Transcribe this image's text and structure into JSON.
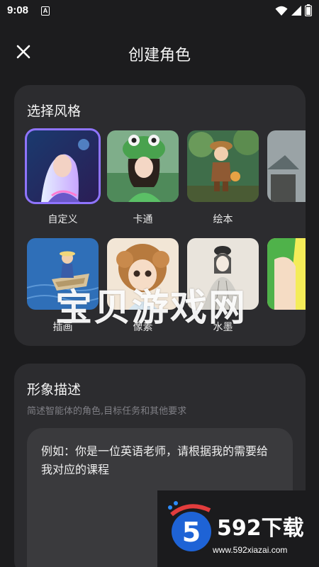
{
  "status_bar": {
    "time": "9:08",
    "notification_badge": "A",
    "icons": [
      "wifi-icon",
      "signal-icon",
      "battery-icon"
    ]
  },
  "header": {
    "title": "创建角色",
    "close_icon": "close-icon"
  },
  "style_section": {
    "heading": "选择风格",
    "items": [
      {
        "label": "自定义",
        "selected": true
      },
      {
        "label": "卡通",
        "selected": false
      },
      {
        "label": "绘本",
        "selected": false
      },
      {
        "label": "",
        "selected": false
      },
      {
        "label": "插画",
        "selected": false
      },
      {
        "label": "像素",
        "selected": false
      },
      {
        "label": "水墨",
        "selected": false
      },
      {
        "label": "",
        "selected": false
      }
    ]
  },
  "description_section": {
    "heading": "形象描述",
    "subtitle": "简述智能体的角色,目标任务和其他要求",
    "value": "例如：你是一位英语老师，请根据我的需要给我对应的课程"
  },
  "watermarks": {
    "center": "宝贝游戏网",
    "logo_number": "5",
    "logo_text": "592下载",
    "logo_url": "www.592xiazai.com"
  },
  "colors": {
    "background": "#1c1c1e",
    "card": "#2c2c2f",
    "input": "#3a3a3d",
    "accent": "#8f74ff"
  }
}
